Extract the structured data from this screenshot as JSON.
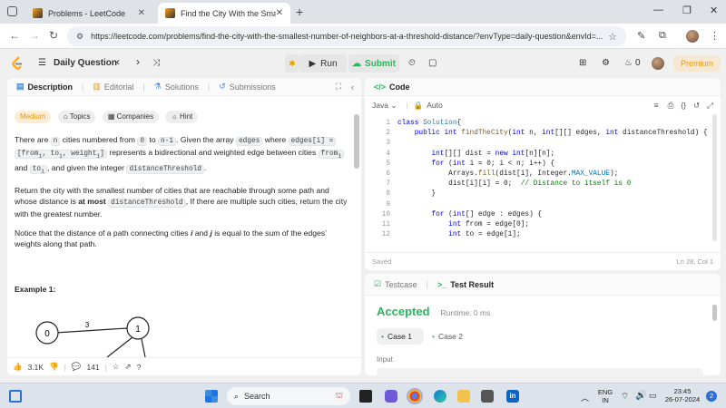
{
  "browser": {
    "tabs": [
      {
        "title": "Problems - LeetCode"
      },
      {
        "title": "Find the City With the Smallest"
      }
    ],
    "url": "https://leetcode.com/problems/find-the-city-with-the-smallest-number-of-neighbors-at-a-threshold-distance/?envType=daily-question&envId=..."
  },
  "header": {
    "daily_question": "Daily Question",
    "run": "Run",
    "submit": "Submit",
    "points": "0",
    "premium": "Premium"
  },
  "description": {
    "tabs": [
      "Description",
      "Editorial",
      "Solutions",
      "Submissions"
    ],
    "difficulty": "Medium",
    "chips": [
      "Topics",
      "Companies",
      "Hint"
    ],
    "para1": {
      "t1": "There are ",
      "c1": "n",
      "t2": " cities numbered from ",
      "c2": "0",
      "t3": " to ",
      "c3": "n-1",
      "t4": ". Given the array ",
      "c4": "edges",
      "t5": " where ",
      "c5": "edges[i] =",
      "c6": "[from",
      "sub1": "i",
      "t6": ", ",
      "c7": "to",
      "sub2": "i",
      "t7": ", ",
      "c8": "weight",
      "sub3": "i",
      "c9": "]",
      "t8": " represents a bidirectional and weighted edge between cities ",
      "c10": "from",
      "sub4": "i",
      "t9": " and ",
      "c11": "to",
      "sub5": "i",
      "t10": ", and given the integer ",
      "c12": "distanceThreshold",
      "t11": "."
    },
    "para2": {
      "t1": "Return the city with the smallest number of cities that are reachable through some path and whose distance is ",
      "b1": "at most",
      "t2": " ",
      "c1": "distanceThreshold",
      "t3": ", If there are multiple such cities, return the city with the greatest number."
    },
    "para3": {
      "t1": "Notice that the distance of a path connecting cities ",
      "i1": "i",
      "t2": " and ",
      "i2": "j",
      "t3": " is equal to the sum of the edges' weights along that path."
    },
    "example_title": "Example 1:",
    "graph": {
      "node_a": "0",
      "node_b": "1",
      "edge_label": "3"
    },
    "footer": {
      "likes": "3.1K",
      "comments": "141"
    }
  },
  "code": {
    "title": "Code",
    "language": "Java",
    "auto": "Auto",
    "lines": [
      {
        "n": "1",
        "segs": [
          [
            "kw",
            "class "
          ],
          [
            "ty",
            "Solution"
          ],
          [
            "",
            "{"
          ]
        ]
      },
      {
        "n": "2",
        "segs": [
          [
            "",
            "    "
          ],
          [
            "kw",
            "public int "
          ],
          [
            "fn",
            "findTheCity"
          ],
          [
            "",
            "("
          ],
          [
            "kw",
            "int "
          ],
          [
            "",
            "n, "
          ],
          [
            "kw",
            "int"
          ],
          [
            "",
            "[][] edges, "
          ],
          [
            "kw",
            "int "
          ],
          [
            "",
            "distanceThreshold) {"
          ]
        ]
      },
      {
        "n": "3",
        "segs": [
          [
            "",
            ""
          ]
        ]
      },
      {
        "n": "4",
        "segs": [
          [
            "",
            "        "
          ],
          [
            "kw",
            "int"
          ],
          [
            "",
            "[][] dist = "
          ],
          [
            "kw",
            "new int"
          ],
          [
            "",
            "[n][n];"
          ]
        ]
      },
      {
        "n": "5",
        "segs": [
          [
            "",
            "        "
          ],
          [
            "kw",
            "for "
          ],
          [
            "",
            "("
          ],
          [
            "kw",
            "int "
          ],
          [
            "",
            "i = 0; i < n; i++) {"
          ]
        ]
      },
      {
        "n": "6",
        "segs": [
          [
            "",
            "            Arrays."
          ],
          [
            "fn",
            "fill"
          ],
          [
            "",
            "(dist[i], Integer."
          ],
          [
            "cst",
            "MAX_VALUE"
          ],
          [
            "",
            ");"
          ]
        ]
      },
      {
        "n": "7",
        "segs": [
          [
            "",
            "            dist[i][i] = 0;  "
          ],
          [
            "cm",
            "// Distance to itself is 0"
          ]
        ]
      },
      {
        "n": "8",
        "segs": [
          [
            "",
            "        }"
          ]
        ]
      },
      {
        "n": "9",
        "segs": [
          [
            "",
            ""
          ]
        ]
      },
      {
        "n": "10",
        "segs": [
          [
            "",
            "        "
          ],
          [
            "kw",
            "for "
          ],
          [
            "",
            "("
          ],
          [
            "kw",
            "int"
          ],
          [
            "",
            "[] edge : edges) {"
          ]
        ]
      },
      {
        "n": "11",
        "segs": [
          [
            "",
            "            "
          ],
          [
            "kw",
            "int "
          ],
          [
            "",
            "from = edge[0];"
          ]
        ]
      },
      {
        "n": "12",
        "segs": [
          [
            "",
            "            "
          ],
          [
            "kw",
            "int "
          ],
          [
            "",
            "to = edge[1];"
          ]
        ]
      }
    ],
    "saved": "Saved",
    "cursor": "Ln 28, Col 1"
  },
  "result": {
    "tabs": [
      "Testcase",
      "Test Result"
    ],
    "status": "Accepted",
    "runtime": "Runtime: 0 ms",
    "cases": [
      "Case 1",
      "Case 2"
    ],
    "input_label": "Input"
  },
  "taskbar": {
    "search": "Search",
    "lang": "ENG",
    "region": "IN",
    "time": "23:45",
    "date": "26-07-2024",
    "notif": "2"
  },
  "colors": {
    "accent": "#ffa116",
    "green": "#2db55d",
    "accepted": "#2db55d",
    "blue_link": "#3c8dde"
  }
}
